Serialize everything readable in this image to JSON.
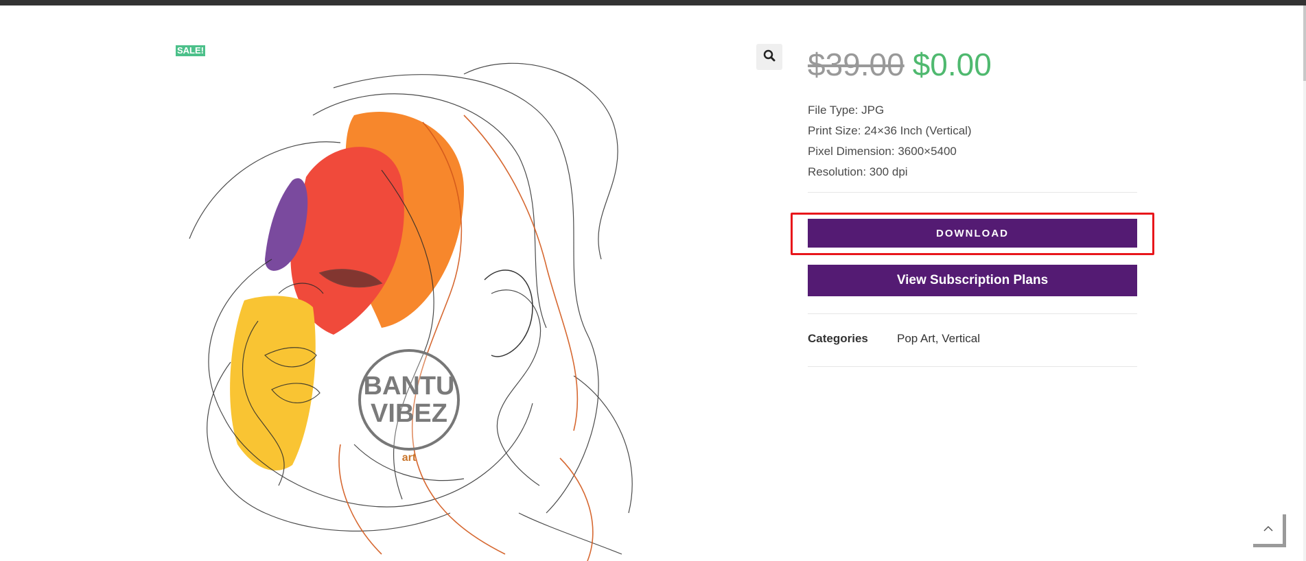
{
  "badge": {
    "sale": "SALE!"
  },
  "image": {
    "watermark_top": "BANTU",
    "watermark_bottom": "VIBEZ",
    "watermark_small": "art"
  },
  "price": {
    "old": "$39.00",
    "new": "$0.00"
  },
  "specs": [
    "File Type: JPG",
    "Print Size: 24×36 Inch (Vertical)",
    "Pixel Dimension: 3600×5400",
    "Resolution: 300 dpi"
  ],
  "buttons": {
    "download": "DOWNLOAD",
    "subscribe": "View Subscription Plans"
  },
  "meta": {
    "categories_label": "Categories",
    "category_1": "Pop Art",
    "separator": ", ",
    "category_2": "Vertical"
  },
  "icons": {
    "zoom": "magnifier-icon",
    "back_to_top": "chevron-up-icon"
  },
  "colors": {
    "accent": "#541b73",
    "sale_badge": "#4cc08a",
    "price_new": "#4fb96f",
    "highlight": "#e8161b"
  }
}
